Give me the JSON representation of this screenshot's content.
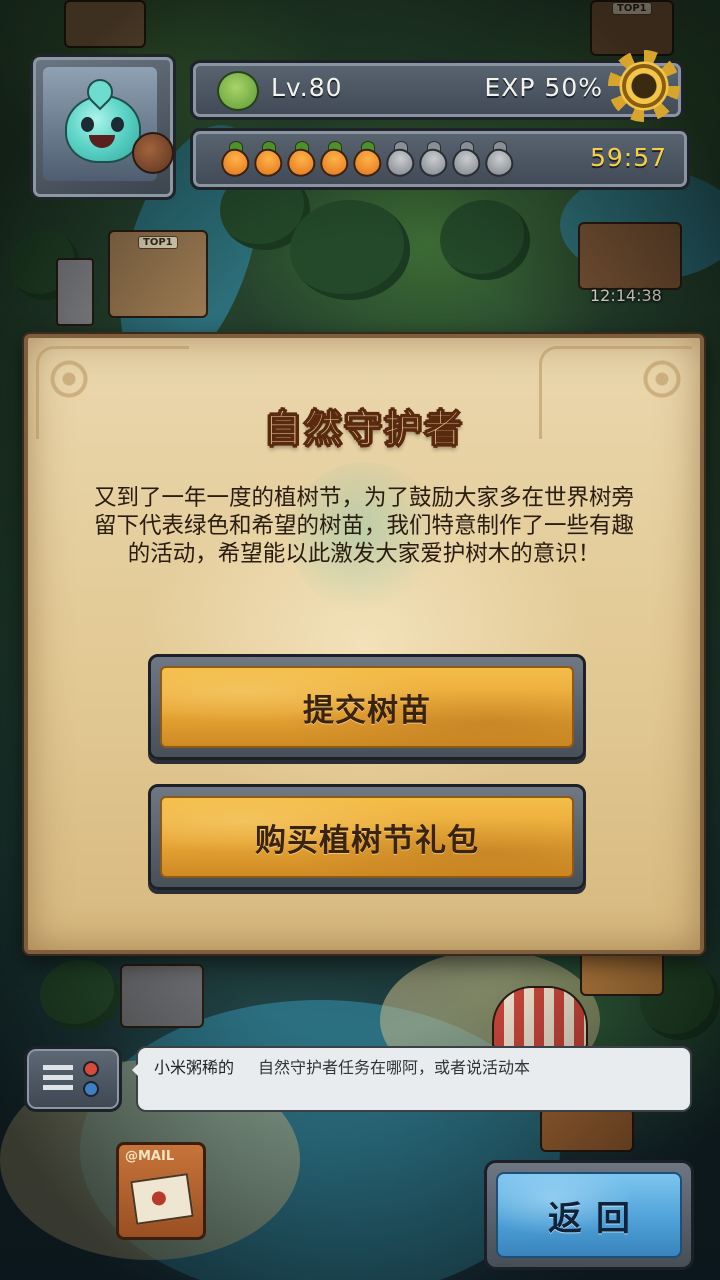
{
  "hud": {
    "level_text": "Lv.80",
    "exp_text": "EXP 50%",
    "energy": {
      "filled": 5,
      "total": 9
    },
    "energy_timer": "59:57",
    "icons": {
      "level": "leaf-icon",
      "settings": "gear-icon",
      "energy": "carrot-icon"
    }
  },
  "map": {
    "building_timer": "12:14:38",
    "top_badge": "TOP1"
  },
  "dialog": {
    "title": "自然守护者",
    "body": "又到了一年一度的植树节，为了鼓励大家多在世界树旁留下代表绿色和希望的树苗，我们特意制作了一些有趣的活动，希望能以此激发大家爱护树木的意识！",
    "buttons": [
      "提交树苗",
      "购买植树节礼包"
    ]
  },
  "chat": {
    "user": "小米粥稀的",
    "message": "自然守护者任务在哪阿，或者说活动本"
  },
  "mail": {
    "label": "@MAIL"
  },
  "back_button": {
    "label": "返回"
  },
  "colors": {
    "dialog_parchment": "#e2c994",
    "button_gold": "#e7a636",
    "back_blue": "#4c9fd6",
    "timer_yellow": "#f5cf47"
  }
}
